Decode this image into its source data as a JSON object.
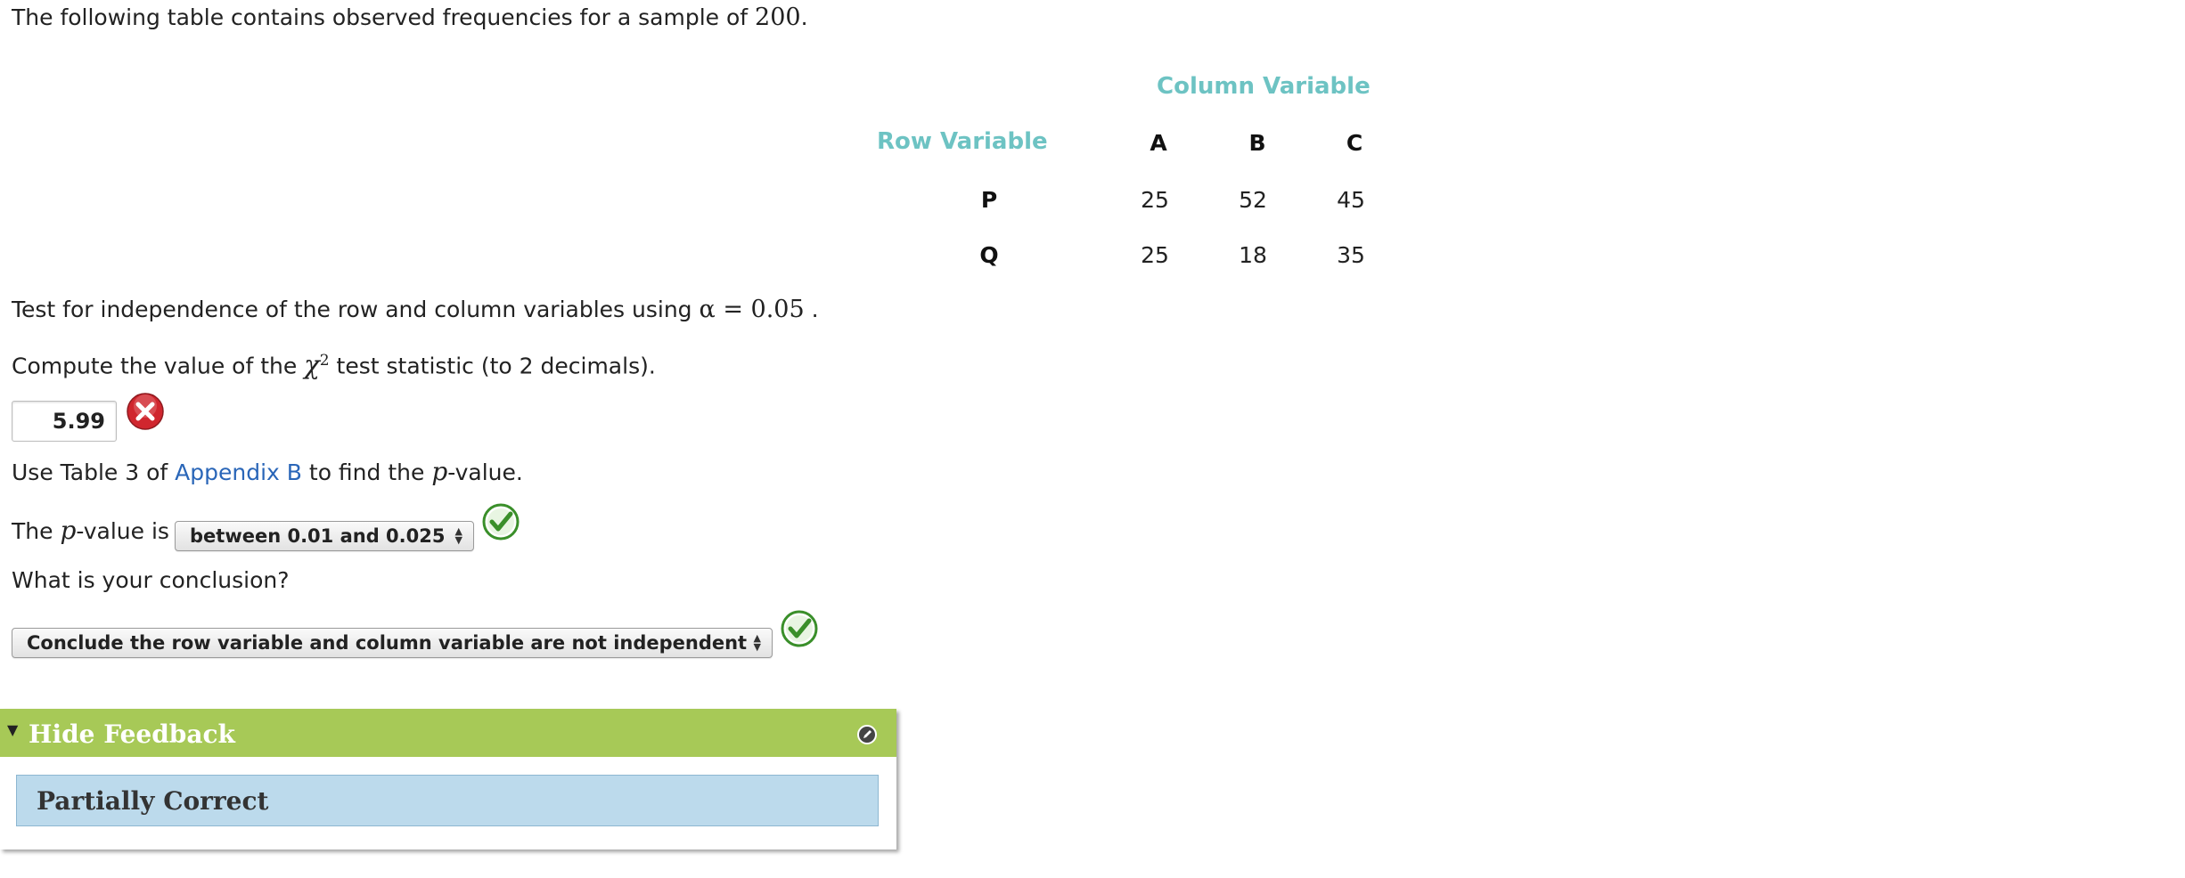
{
  "intro": {
    "text": "The following table contains observed frequencies for a sample of",
    "n": "200",
    "end": "."
  },
  "table": {
    "column_header": "Column Variable",
    "row_header": "Row Variable",
    "columns": [
      "A",
      "B",
      "C"
    ],
    "rows": [
      {
        "label": "P",
        "values": [
          "25",
          "52",
          "45"
        ]
      },
      {
        "label": "Q",
        "values": [
          "25",
          "18",
          "35"
        ]
      }
    ]
  },
  "test_text": {
    "before": "Test for independence of the row and column variables using",
    "alpha": "α = 0.05",
    "after": " ."
  },
  "compute_text": {
    "before": "Compute the value of the",
    "chi": "χ",
    "sup": "2",
    "after": "test statistic (to 2 decimals)."
  },
  "chi_answer": {
    "value": "5.99",
    "status": "incorrect"
  },
  "use_table": {
    "before": "Use Table 3 of",
    "link": "Appendix B",
    "after": "to find the",
    "p": "p",
    "end": "-value."
  },
  "pvalue": {
    "before": "The",
    "p": "p",
    "after": "-value is",
    "selected": "between 0.01 and 0.025",
    "status": "correct"
  },
  "conclusion": {
    "question": "What is your conclusion?",
    "selected": "Conclude the row variable and column variable are not independent",
    "status": "correct"
  },
  "feedback": {
    "title": "Hide Feedback",
    "status": "Partially Correct"
  },
  "colors": {
    "teal": "#6dc3c3",
    "feedback_green": "#a7c957",
    "feedback_blue": "#bcdaec",
    "error_red": "#d0262e",
    "check_green": "#3a8f2a",
    "link": "#2a66b8"
  }
}
